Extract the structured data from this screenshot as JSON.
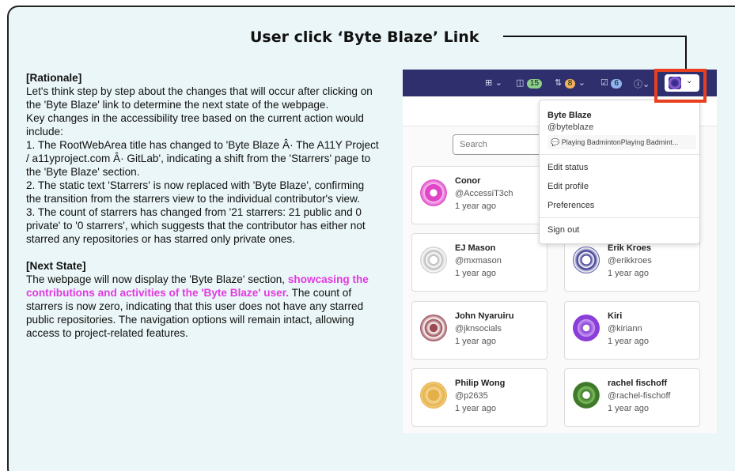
{
  "headline": "User click ‘Byte Blaze’ Link",
  "rationale": {
    "title": "[Rationale]",
    "paragraphs": [
      "Let's think step by step about the changes that will occur after clicking on the 'Byte Blaze' link to determine the next state of the webpage.",
      "Key changes in the accessibility tree based on the current action would include:",
      "1. The RootWebArea title has changed to 'Byte Blaze Â· The A11Y Project / a11yproject.com Â· GitLab', indicating a shift from the 'Starrers' page to the 'Byte Blaze' section.",
      "2. The static text 'Starrers' is now replaced with 'Byte Blaze', confirming the transition from the starrers view to the individual contributor's view.",
      "3. The count of starrers has changed from '21 starrers: 21 public and 0 private' to '0 starrers', which suggests that the contributor has either not starred any repositories or has starred only private ones."
    ],
    "next_title": "[Next State]",
    "next_intro": "The webpage will now display the 'Byte Blaze' section,",
    "next_highlight": "showcasing the contributions and activities of the 'Byte Blaze' user.",
    "next_rest": "The count of starrers is now zero, indicating that this user does not have any starred public repositories. The navigation options will remain intact, allowing access to project-related features."
  },
  "topbar": {
    "badge_mr": "15",
    "badge_issues": "8",
    "badge_todo": "6"
  },
  "search": {
    "placeholder": "Search"
  },
  "dropdown": {
    "name": "Byte Blaze",
    "handle": "@byteblaze",
    "status": "💬 Playing BadmintonPlaying Badmint...",
    "items": [
      "Edit status",
      "Edit profile",
      "Preferences",
      "Sign out"
    ]
  },
  "cards": [
    {
      "name": "Conor",
      "handle": "@AccessiT3ch",
      "time": "1 year ago"
    },
    {
      "name": "EJ Mason",
      "handle": "@mxmason",
      "time": "1 year ago"
    },
    {
      "name": "Erik Kroes",
      "handle": "@erikkroes",
      "time": "1 year ago"
    },
    {
      "name": "John Nyaruiru",
      "handle": "@jknsocials",
      "time": "1 year ago"
    },
    {
      "name": "Kiri",
      "handle": "@kiriann",
      "time": "1 year ago"
    },
    {
      "name": "Philip Wong",
      "handle": "@p2635",
      "time": "1 year ago"
    },
    {
      "name": "rachel fischoff",
      "handle": "@rachel-fischoff",
      "time": "1 year ago"
    }
  ],
  "colors": {
    "highlight": "#e33ae0",
    "annotation_box": "#e8401e",
    "topbar": "#2f2f6e"
  }
}
